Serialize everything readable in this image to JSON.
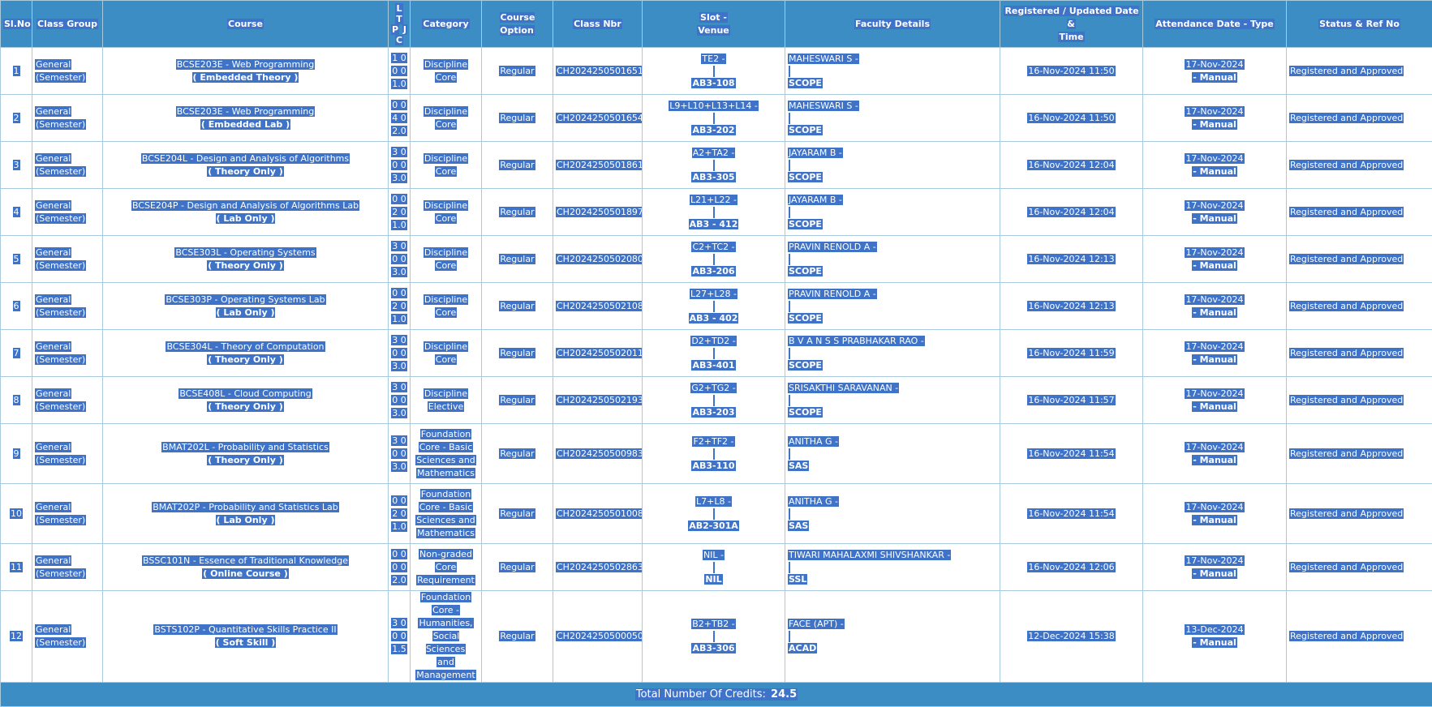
{
  "headers": {
    "slno": "Sl.No",
    "class_group": "Class Group",
    "course": "Course",
    "ltpc": [
      "L",
      "T",
      "P",
      "J",
      "C"
    ],
    "category": "Category",
    "course_option": "Course Option",
    "class_nbr": "Class Nbr",
    "slot_venue": [
      "Slot -",
      "Venue"
    ],
    "faculty": "Faculty Details",
    "registered": [
      "Registered / Updated Date &",
      "Time"
    ],
    "attendance": "Attendance Date - Type",
    "status": "Status & Ref No"
  },
  "rows": [
    {
      "slno": "1",
      "group": [
        "General",
        "(Semester)"
      ],
      "course": "BCSE203E - Web Programming",
      "ctype": "( Embedded Theory )",
      "ltpc": [
        "1 0",
        "0 0",
        "1.0"
      ],
      "category": [
        "Discipline",
        "Core"
      ],
      "option": "Regular",
      "nbr": "CH2024250501651",
      "slot": "TE2 -",
      "venue": "AB3-108",
      "faculty": "MAHESWARI S -",
      "school": "SCOPE",
      "registered": "16-Nov-2024 11:50",
      "att_date": "17-Nov-2024",
      "att_type": "- Manual",
      "status": "Registered and Approved"
    },
    {
      "slno": "2",
      "group": [
        "General",
        "(Semester)"
      ],
      "course": "BCSE203E - Web Programming",
      "ctype": "( Embedded Lab )",
      "ltpc": [
        "0 0",
        "4 0",
        "2.0"
      ],
      "category": [
        "Discipline",
        "Core"
      ],
      "option": "Regular",
      "nbr": "CH2024250501654",
      "slot": "L9+L10+L13+L14 -",
      "venue": "AB3-202",
      "faculty": "MAHESWARI S -",
      "school": "SCOPE",
      "registered": "16-Nov-2024 11:50",
      "att_date": "17-Nov-2024",
      "att_type": "- Manual",
      "status": "Registered and Approved"
    },
    {
      "slno": "3",
      "group": [
        "General",
        "(Semester)"
      ],
      "course": "BCSE204L - Design and Analysis of Algorithms",
      "ctype": "( Theory Only )",
      "ltpc": [
        "3 0",
        "0 0",
        "3.0"
      ],
      "category": [
        "Discipline",
        "Core"
      ],
      "option": "Regular",
      "nbr": "CH2024250501861",
      "slot": "A2+TA2 -",
      "venue": "AB3-305",
      "faculty": "JAYARAM B -",
      "school": "SCOPE",
      "registered": "16-Nov-2024 12:04",
      "att_date": "17-Nov-2024",
      "att_type": "- Manual",
      "status": "Registered and Approved"
    },
    {
      "slno": "4",
      "group": [
        "General",
        "(Semester)"
      ],
      "course": "BCSE204P - Design and Analysis of Algorithms Lab",
      "ctype": "( Lab Only )",
      "ltpc": [
        "0 0",
        "2 0",
        "1.0"
      ],
      "category": [
        "Discipline",
        "Core"
      ],
      "option": "Regular",
      "nbr": "CH2024250501897",
      "slot": "L21+L22 -",
      "venue": "AB3 - 412",
      "faculty": "JAYARAM B -",
      "school": "SCOPE",
      "registered": "16-Nov-2024 12:04",
      "att_date": "17-Nov-2024",
      "att_type": "- Manual",
      "status": "Registered and Approved"
    },
    {
      "slno": "5",
      "group": [
        "General",
        "(Semester)"
      ],
      "course": "BCSE303L - Operating Systems",
      "ctype": "( Theory Only )",
      "ltpc": [
        "3 0",
        "0 0",
        "3.0"
      ],
      "category": [
        "Discipline",
        "Core"
      ],
      "option": "Regular",
      "nbr": "CH2024250502080",
      "slot": "C2+TC2 -",
      "venue": "AB3-206",
      "faculty": "PRAVIN RENOLD A -",
      "school": "SCOPE",
      "registered": "16-Nov-2024 12:13",
      "att_date": "17-Nov-2024",
      "att_type": "- Manual",
      "status": "Registered and Approved"
    },
    {
      "slno": "6",
      "group": [
        "General",
        "(Semester)"
      ],
      "course": "BCSE303P - Operating Systems Lab",
      "ctype": "( Lab Only )",
      "ltpc": [
        "0 0",
        "2 0",
        "1.0"
      ],
      "category": [
        "Discipline",
        "Core"
      ],
      "option": "Regular",
      "nbr": "CH2024250502108",
      "slot": "L27+L28 -",
      "venue": "AB3 - 402",
      "faculty": "PRAVIN RENOLD A -",
      "school": "SCOPE",
      "registered": "16-Nov-2024 12:13",
      "att_date": "17-Nov-2024",
      "att_type": "- Manual",
      "status": "Registered and Approved"
    },
    {
      "slno": "7",
      "group": [
        "General",
        "(Semester)"
      ],
      "course": "BCSE304L - Theory of Computation",
      "ctype": "( Theory Only )",
      "ltpc": [
        "3 0",
        "0 0",
        "3.0"
      ],
      "category": [
        "Discipline",
        "Core"
      ],
      "option": "Regular",
      "nbr": "CH2024250502011",
      "slot": "D2+TD2 -",
      "venue": "AB3-401",
      "faculty": "B V A N S S PRABHAKAR RAO -",
      "school": "SCOPE",
      "registered": "16-Nov-2024 11:59",
      "att_date": "17-Nov-2024",
      "att_type": "- Manual",
      "status": "Registered and Approved"
    },
    {
      "slno": "8",
      "group": [
        "General",
        "(Semester)"
      ],
      "course": "BCSE408L - Cloud Computing",
      "ctype": "( Theory Only )",
      "ltpc": [
        "3 0",
        "0 0",
        "3.0"
      ],
      "category": [
        "Discipline",
        "Elective"
      ],
      "option": "Regular",
      "nbr": "CH2024250502193",
      "slot": "G2+TG2 -",
      "venue": "AB3-203",
      "faculty": "SRISAKTHI SARAVANAN -",
      "school": "SCOPE",
      "registered": "16-Nov-2024 11:57",
      "att_date": "17-Nov-2024",
      "att_type": "- Manual",
      "status": "Registered and Approved"
    },
    {
      "slno": "9",
      "group": [
        "General",
        "(Semester)"
      ],
      "course": "BMAT202L - Probability and Statistics",
      "ctype": "( Theory Only )",
      "ltpc": [
        "3 0",
        "0 0",
        "3.0"
      ],
      "category": [
        "Foundation",
        "Core - Basic",
        "Sciences and",
        "Mathematics"
      ],
      "option": "Regular",
      "nbr": "CH2024250500983",
      "slot": "F2+TF2 -",
      "venue": "AB3-110",
      "faculty": "ANITHA G -",
      "school": "SAS",
      "registered": "16-Nov-2024 11:54",
      "att_date": "17-Nov-2024",
      "att_type": "- Manual",
      "status": "Registered and Approved"
    },
    {
      "slno": "10",
      "group": [
        "General",
        "(Semester)"
      ],
      "course": "BMAT202P - Probability and Statistics Lab",
      "ctype": "( Lab Only )",
      "ltpc": [
        "0 0",
        "2 0",
        "1.0"
      ],
      "category": [
        "Foundation",
        "Core - Basic",
        "Sciences and",
        "Mathematics"
      ],
      "option": "Regular",
      "nbr": "CH2024250501008",
      "slot": "L7+L8 -",
      "venue": "AB2-301A",
      "faculty": "ANITHA G -",
      "school": "SAS",
      "registered": "16-Nov-2024 11:54",
      "att_date": "17-Nov-2024",
      "att_type": "- Manual",
      "status": "Registered and Approved"
    },
    {
      "slno": "11",
      "group": [
        "General",
        "(Semester)"
      ],
      "course": "BSSC101N - Essence of Traditional Knowledge",
      "ctype": "( Online Course )",
      "ltpc": [
        "0 0",
        "0 0",
        "2.0"
      ],
      "category": [
        "Non-graded",
        "Core",
        "Requirement"
      ],
      "option": "Regular",
      "nbr": "CH2024250502863",
      "slot": "NIL -",
      "venue": "NIL",
      "faculty": "TIWARI MAHALAXMI SHIVSHANKAR -",
      "school": "SSL",
      "registered": "16-Nov-2024 12:06",
      "att_date": "17-Nov-2024",
      "att_type": "- Manual",
      "status": "Registered and Approved"
    },
    {
      "slno": "12",
      "group": [
        "General",
        "(Semester)"
      ],
      "course": "BSTS102P - Quantitative Skills Practice II",
      "ctype": "( Soft Skill )",
      "ltpc": [
        "3 0",
        "0 0",
        "1.5"
      ],
      "category": [
        "Foundation",
        "Core -",
        "Humanities,",
        "Social Sciences",
        "and",
        "Management"
      ],
      "option": "Regular",
      "nbr": "CH2024250500050",
      "slot": "B2+TB2 -",
      "venue": "AB3-306",
      "faculty": "FACE (APT) -",
      "school": "ACAD",
      "registered": "12-Dec-2024 15:38",
      "att_date": "13-Dec-2024",
      "att_type": "- Manual",
      "status": "Registered and Approved"
    }
  ],
  "footer": {
    "label": "Total Number Of Credits: ",
    "value": "24.5"
  }
}
